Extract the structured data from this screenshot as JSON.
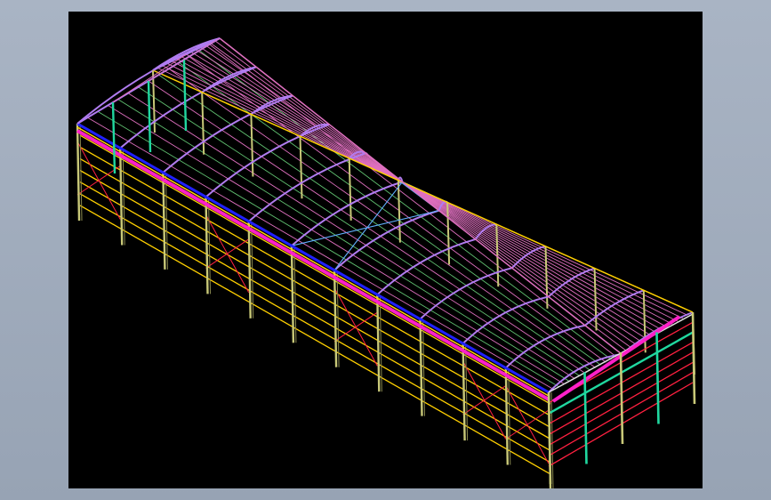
{
  "background": {
    "outer": "#a2adbd",
    "viewport": "#000000"
  },
  "colors": {
    "rafter": "#b07cf0",
    "purlin": "#e070c0",
    "column": "#c8c878",
    "girt": "#ffd000",
    "wall_brace": "#ff2040",
    "end_column": "#20d8a0",
    "eave_beam": "#ff20c8",
    "eave_blue": "#2020ff",
    "roof_brace": "#60c070",
    "x_brace": "#60b0ff"
  },
  "structure": {
    "frame_count": 12,
    "girt_levels": 7
  }
}
